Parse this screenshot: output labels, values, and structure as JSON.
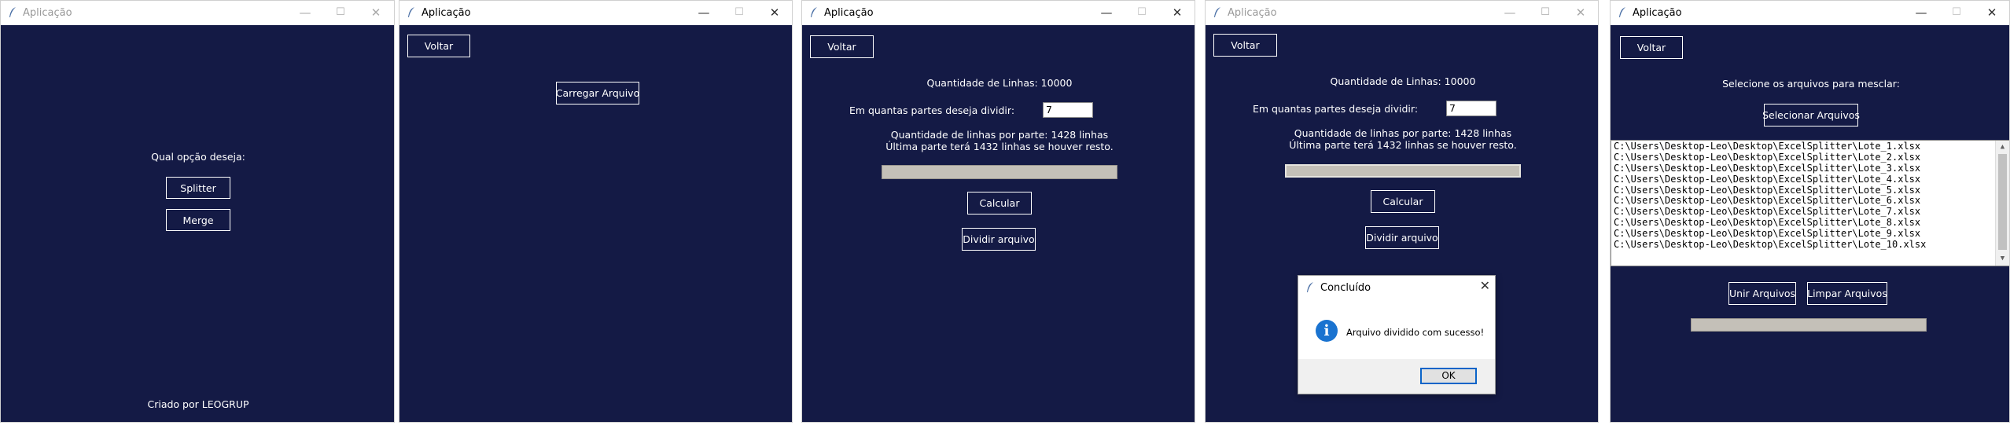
{
  "colors": {
    "background": "#141a45",
    "foreground": "#ffffff",
    "progress": "#c4c0b8",
    "info_icon": "#1a73d0"
  },
  "window_title": "Aplicação",
  "titlebar": {
    "minimize": "—",
    "maximize": "☐",
    "close": "✕"
  },
  "icons": {
    "app": "feather-icon",
    "info": "info-icon"
  },
  "win1": {
    "question": "Qual opção deseja:",
    "splitter_button": "Splitter",
    "merge_button": "Merge",
    "credit": "Criado por LEOGRUP"
  },
  "win2": {
    "back_button": "Voltar",
    "load_button": "Carregar Arquivo"
  },
  "win3": {
    "back_button": "Voltar",
    "lines_label": "Quantidade de Linhas: 10000",
    "parts_label": "Em quantas partes deseja dividir:",
    "parts_value": "7",
    "per_part_line1": "Quantidade de linhas por parte: 1428 linhas",
    "per_part_line2": "Última parte terá 1432 linhas se houver resto.",
    "progress": 0,
    "calc_button": "Calcular",
    "split_button": "Dividir arquivo"
  },
  "win4": {
    "back_button": "Voltar",
    "lines_label": "Quantidade de Linhas: 10000",
    "parts_label": "Em quantas partes deseja dividir:",
    "parts_value": "7",
    "per_part_line1": "Quantidade de linhas por parte: 1428 linhas",
    "per_part_line2": "Última parte terá 1432 linhas se houver resto.",
    "progress": 1,
    "calc_button": "Calcular",
    "split_button": "Dividir arquivo",
    "dialog": {
      "title": "Concluído",
      "close": "✕",
      "info_glyph": "i",
      "message": "Arquivo dividido com sucesso!",
      "ok_button": "OK"
    }
  },
  "win5": {
    "back_button": "Voltar",
    "prompt": "Selecione os arquivos para mesclar:",
    "select_button": "Selecionar Arquivos",
    "files": [
      "C:\\Users\\Desktop-Leo\\Desktop\\ExcelSplitter\\Lote_1.xlsx",
      "C:\\Users\\Desktop-Leo\\Desktop\\ExcelSplitter\\Lote_2.xlsx",
      "C:\\Users\\Desktop-Leo\\Desktop\\ExcelSplitter\\Lote_3.xlsx",
      "C:\\Users\\Desktop-Leo\\Desktop\\ExcelSplitter\\Lote_4.xlsx",
      "C:\\Users\\Desktop-Leo\\Desktop\\ExcelSplitter\\Lote_5.xlsx",
      "C:\\Users\\Desktop-Leo\\Desktop\\ExcelSplitter\\Lote_6.xlsx",
      "C:\\Users\\Desktop-Leo\\Desktop\\ExcelSplitter\\Lote_7.xlsx",
      "C:\\Users\\Desktop-Leo\\Desktop\\ExcelSplitter\\Lote_8.xlsx",
      "C:\\Users\\Desktop-Leo\\Desktop\\ExcelSplitter\\Lote_9.xlsx",
      "C:\\Users\\Desktop-Leo\\Desktop\\ExcelSplitter\\Lote_10.xlsx"
    ],
    "scroll_up": "▲",
    "scroll_down": "▼",
    "merge_button": "Unir Arquivos",
    "clear_button": "Limpar Arquivos",
    "progress": 0
  }
}
